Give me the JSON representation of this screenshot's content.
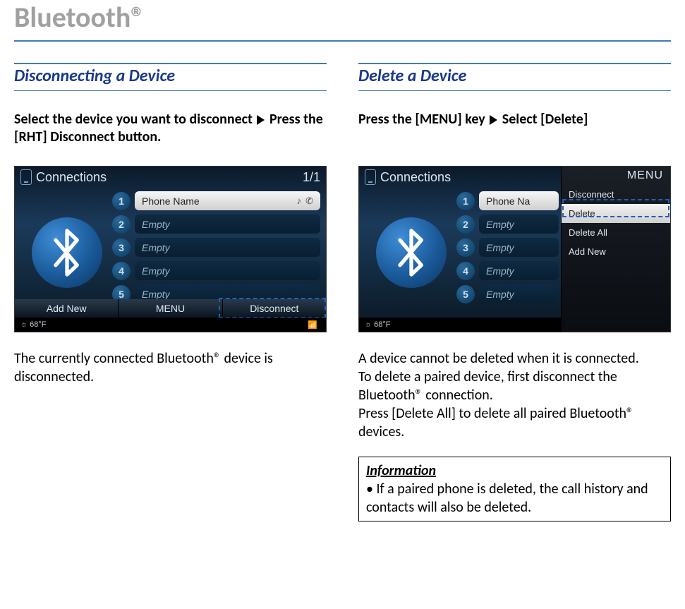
{
  "page_title": "Bluetooth®",
  "left": {
    "section_title": "Disconnecting a Device",
    "instruction_before": "Select the device you want to disconnect",
    "instruction_after": "Press the [RHT] Disconnect button.",
    "body_text": "The currently connected Bluetooth® device is disconnected.",
    "device": {
      "header_title": "Connections",
      "page_indicator": "1/1",
      "slots": [
        {
          "num": "1",
          "label": "Phone Name",
          "selected": true
        },
        {
          "num": "2",
          "label": "Empty",
          "selected": false
        },
        {
          "num": "3",
          "label": "Empty",
          "selected": false
        },
        {
          "num": "4",
          "label": "Empty",
          "selected": false
        },
        {
          "num": "5",
          "label": "Empty",
          "selected": false
        }
      ],
      "footer": {
        "left": "Add New",
        "center": "MENU",
        "right": "Disconnect"
      },
      "status_temp": "68°F"
    }
  },
  "right": {
    "section_title": "Delete a Device",
    "instruction_before": "Press the [MENU] key",
    "instruction_after": "Select [Delete]",
    "body_text": "A device cannot be deleted when it is connected.\nTo delete a paired device, first disconnect the Bluetooth® connection.\nPress [Delete All] to delete all paired Bluetooth® devices.",
    "device": {
      "header_title": "Connections",
      "menu_title": "MENU",
      "menu_items": [
        "Disconnect",
        "Delete",
        "Delete All",
        "Add New"
      ],
      "selected_menu_index": 1,
      "slots": [
        {
          "num": "1",
          "label": "Phone Na",
          "selected": true
        },
        {
          "num": "2",
          "label": "Empty",
          "selected": false
        },
        {
          "num": "3",
          "label": "Empty",
          "selected": false
        },
        {
          "num": "4",
          "label": "Empty",
          "selected": false
        },
        {
          "num": "5",
          "label": "Empty",
          "selected": false
        }
      ],
      "status_temp": "68°F"
    },
    "info": {
      "heading": "Information",
      "bullet": "• If a paired phone is deleted, the call history and contacts will also be deleted."
    }
  }
}
